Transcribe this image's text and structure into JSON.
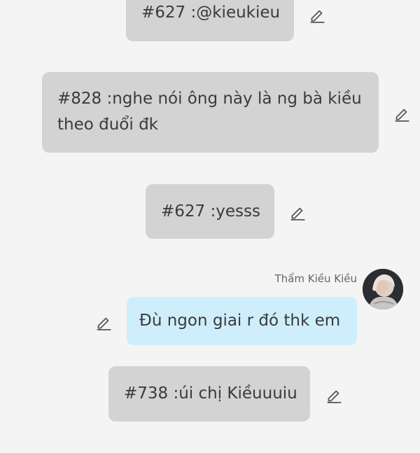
{
  "messages": [
    {
      "text": "#627 :@kieukieu"
    },
    {
      "text": "#828 :nghe nói ông này là ng bà kiều theo đuổi đk"
    },
    {
      "text": "#627 :yesss"
    },
    {
      "sender": "Thẩm Kiều Kiều",
      "text": "Đù ngon giai r đó thk em"
    },
    {
      "text": "#738 :úi chị Kiềuuuiu"
    }
  ],
  "icons": {
    "edit": "pencil-edit-icon",
    "avatar": "user-avatar"
  },
  "colors": {
    "background": "#f4f4f4",
    "anonymous_bubble": "#d3d3d3",
    "own_bubble": "#cfeefb",
    "text": "#3b3b3b"
  }
}
